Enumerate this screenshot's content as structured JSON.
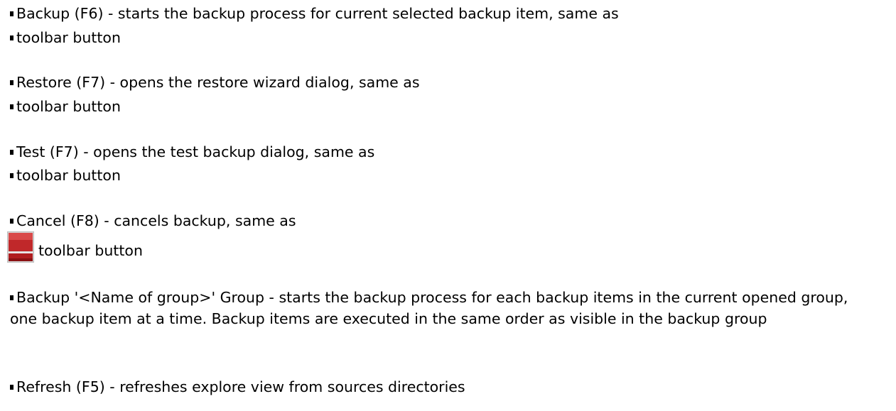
{
  "items": [
    {
      "text": "Backup (F6) - starts the backup process for current selected backup item, same as"
    },
    {
      "text": "toolbar button"
    },
    {
      "text": "Restore (F7) - opens the restore wizard dialog, same as"
    },
    {
      "text": "toolbar button"
    },
    {
      "text": "Test (F7) - opens the test backup dialog, same as"
    },
    {
      "text": "toolbar button"
    },
    {
      "text": "Cancel (F8) - cancels backup, same as"
    },
    {
      "text": "toolbar button",
      "icon": "cancel-stop-icon"
    },
    {
      "text": "Backup '<Name of group>' Group - starts the backup process for each backup items in the current opened group, one backup item at a time. Backup items are executed in the same order as visible in the backup group"
    },
    {
      "text": "Refresh (F5) - refreshes explore view from sources directories"
    }
  ],
  "colors": {
    "text": "#000000",
    "icon_red": "#c0282a",
    "icon_dark_red": "#8a1214",
    "icon_frame": "#c9c9c9"
  }
}
